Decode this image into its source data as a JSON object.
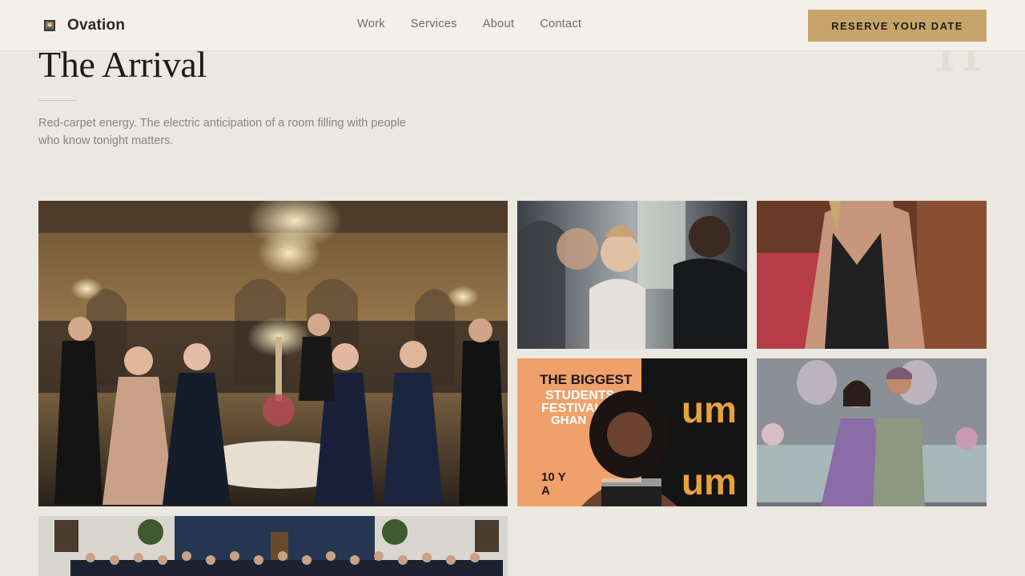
{
  "header": {
    "brand": "Ovation",
    "nav": [
      "Work",
      "Services",
      "About",
      "Contact"
    ],
    "cta_label": "RESERVE YOUR DATE"
  },
  "background_glyph": "H",
  "intro": {
    "title": "The Arrival",
    "description": "Red-carpet energy. The electric anticipation of a room filling with people who know tonight matters."
  },
  "gallery": {
    "photo_banner_lines": [
      "THE BIGGEST",
      "STUDENTS",
      "FESTIVAL",
      "GHAN"
    ],
    "photo_backdrop_logo": "um",
    "photo_banner_sub": "10 Y",
    "photo_banner_sub2": "A"
  },
  "colors": {
    "accent": "#c7a56a",
    "background": "#ebe7e1",
    "header_bg": "#f3f0ec"
  }
}
